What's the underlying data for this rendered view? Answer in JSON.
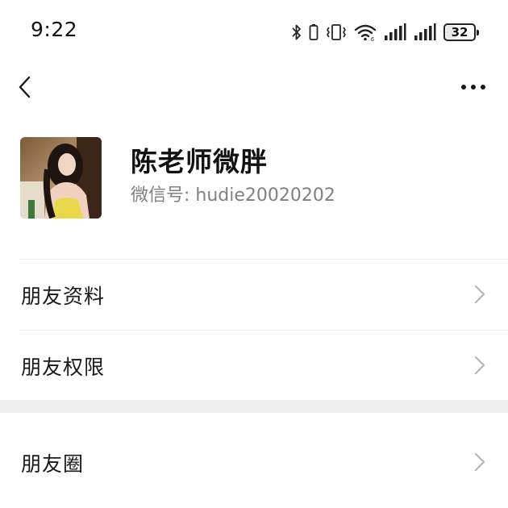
{
  "status_bar": {
    "time": "9:22",
    "battery_level": "32",
    "icons": [
      "bluetooth-icon",
      "vibrate-icon",
      "wifi-icon",
      "signal-icon",
      "signal-icon",
      "battery-icon"
    ]
  },
  "nav": {
    "back_icon": "back-icon",
    "more_icon": "more-icon"
  },
  "profile": {
    "name": "陈老师微胖",
    "wechat_id": "微信号: hudie20020202"
  },
  "menu": {
    "items": [
      {
        "label": "朋友资料"
      },
      {
        "label": "朋友权限"
      },
      {
        "label": "朋友圈"
      }
    ]
  },
  "colors": {
    "background": "#ffffff",
    "divider": "#ededed",
    "secondary_text": "#808080",
    "chevron": "#b2b2b2"
  }
}
